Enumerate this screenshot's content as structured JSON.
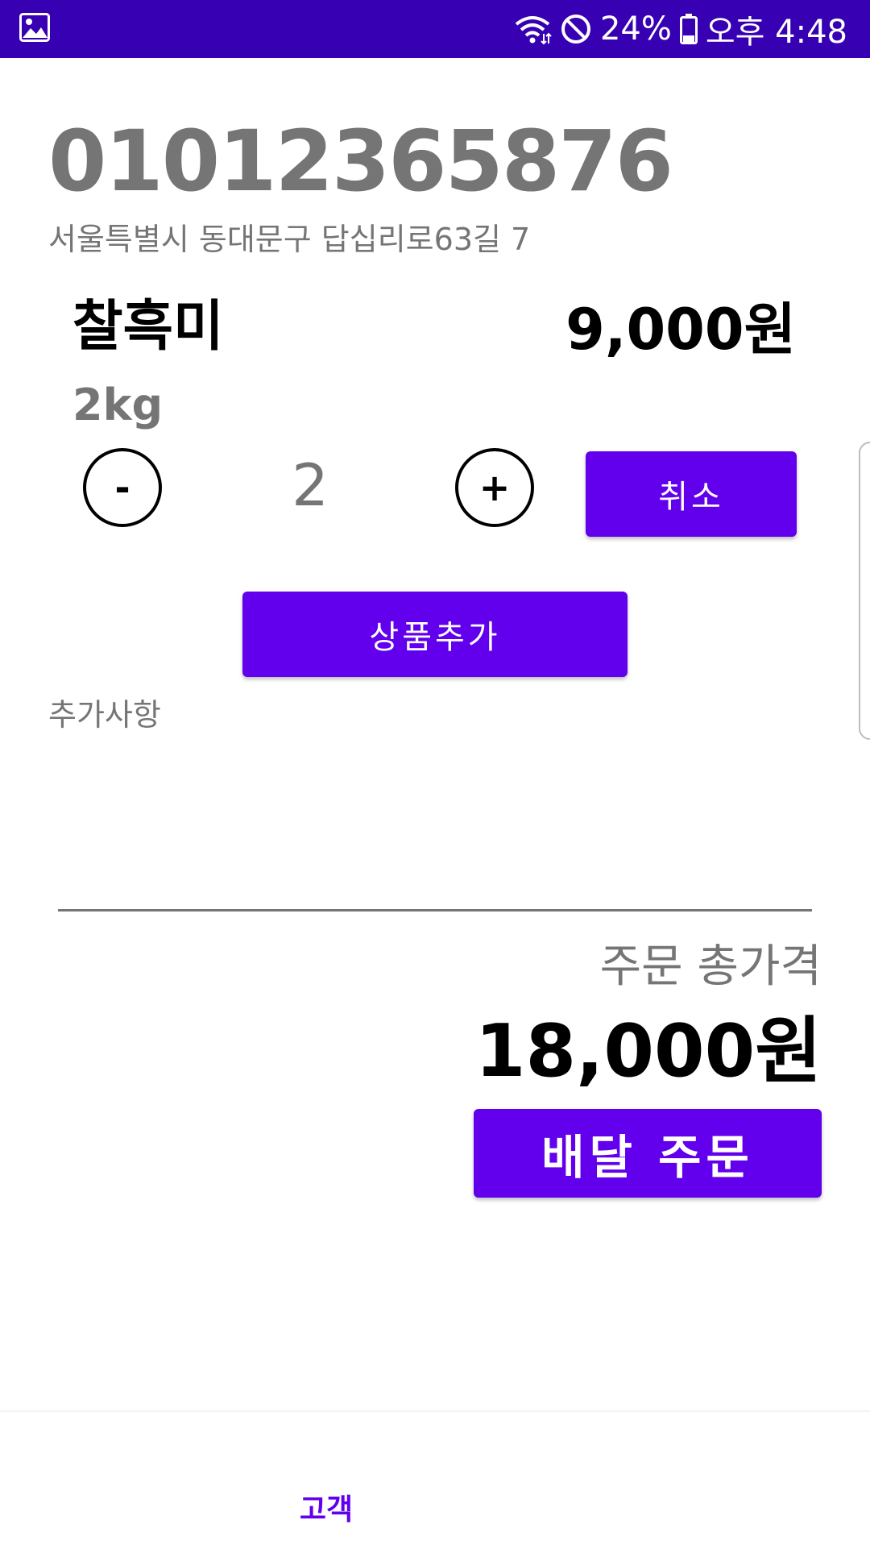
{
  "status_bar": {
    "battery": "24%",
    "time": "오후 4:48",
    "icons": [
      "gallery-icon",
      "wifi-icon",
      "do-not-disturb-icon",
      "battery-icon"
    ]
  },
  "customer": {
    "phone": "01012365876",
    "address": "서울특별시 동대문구 답십리로63길 7"
  },
  "item": {
    "name": "찰흑미",
    "price": "9,000원",
    "weight": "2kg",
    "quantity": "2",
    "minus_label": "-",
    "plus_label": "+",
    "cancel_label": "취소"
  },
  "actions": {
    "add_product_label": "상품추가"
  },
  "extra": {
    "label": "추가사항"
  },
  "summary": {
    "total_label": "주문 총가격",
    "total_value": "18,000원",
    "order_label": "배달 주문"
  },
  "bottom_nav": {
    "items": [
      {
        "label": "고객",
        "selected": true
      }
    ]
  },
  "colors": {
    "status_bar": "#3700b3",
    "primary": "#6200ee",
    "muted_text": "#757575"
  }
}
